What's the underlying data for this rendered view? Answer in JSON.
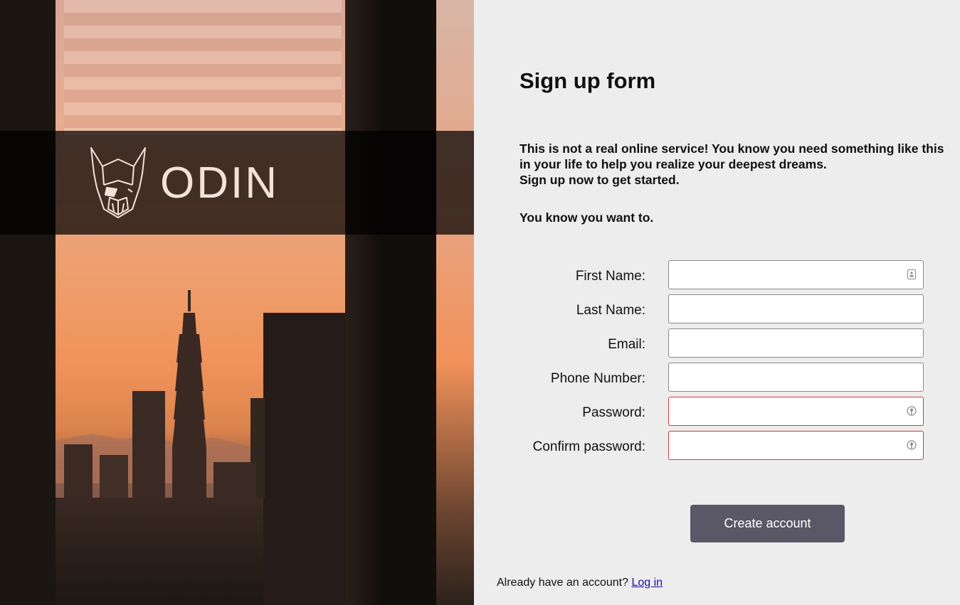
{
  "brand": {
    "name": "ODIN"
  },
  "form": {
    "title": "Sign up form",
    "intro_lines": [
      "This is not a real online service! You know you need something like this in your life to help you realize your deepest dreams.",
      "Sign up now to get started."
    ],
    "intro_tagline": "You know you want to.",
    "fields": [
      {
        "label": "First Name:",
        "value": "",
        "icon": "contact-card-icon",
        "invalid": false
      },
      {
        "label": "Last Name:",
        "value": "",
        "invalid": false
      },
      {
        "label": "Email:",
        "value": "",
        "invalid": false
      },
      {
        "label": "Phone Number:",
        "value": "",
        "invalid": false
      },
      {
        "label": "Password:",
        "value": "",
        "icon": "password-key-icon",
        "invalid": true
      },
      {
        "label": "Confirm password:",
        "value": "",
        "icon": "password-key-icon",
        "invalid": true
      }
    ],
    "submit_label": "Create account",
    "footer_text": "Already have an account?",
    "login_link": "Log in"
  },
  "colors": {
    "button_bg": "#5a5867",
    "invalid_border": "#d23a3a",
    "panel_bg": "#ededed",
    "brand_text": "#f3e2da"
  }
}
